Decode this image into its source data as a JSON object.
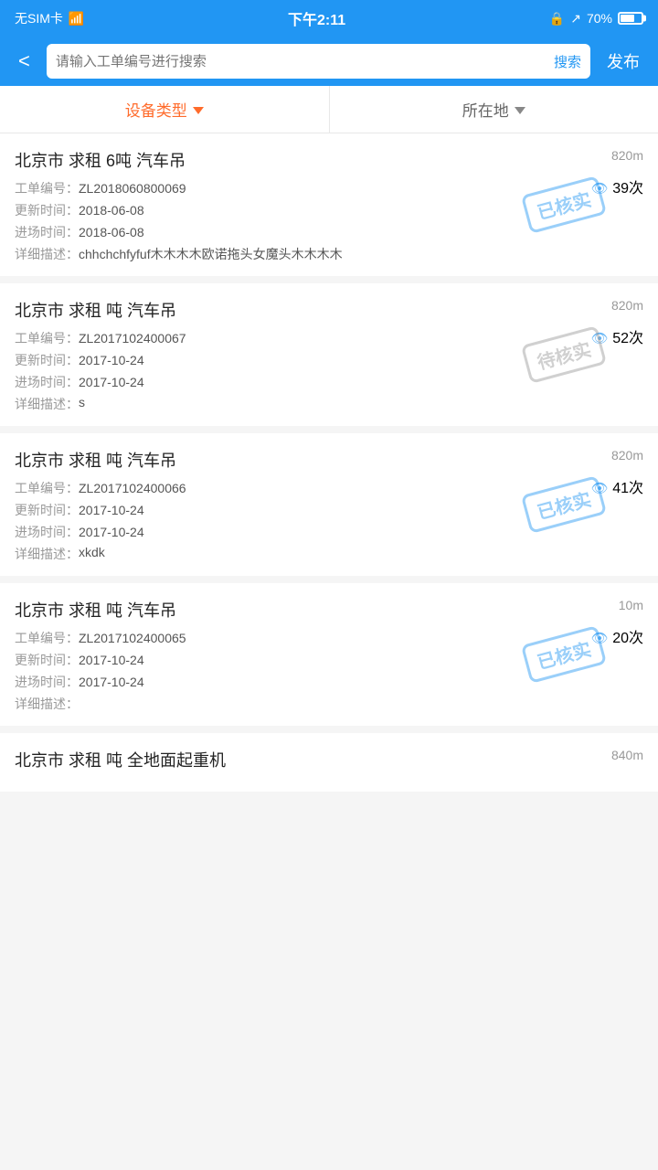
{
  "statusBar": {
    "signal": "无SIM卡",
    "wifi": "WiFi",
    "time": "下午2:11",
    "lock": "🔒",
    "location": "↗",
    "battery": "70%"
  },
  "navBar": {
    "back": "<",
    "searchPlaceholder": "请输入工单编号进行搜索",
    "searchBtn": "搜索",
    "publishBtn": "发布"
  },
  "filters": {
    "type": {
      "label": "设备类型",
      "active": true
    },
    "location": {
      "label": "所在地",
      "active": false
    }
  },
  "items": [
    {
      "title": "北京市 求租 6吨 汽车吊",
      "distance": "820m",
      "orderNo": "ZL2018060800069",
      "views": "39次",
      "updateTime": "2018-06-08",
      "entryTime": "2018-06-08",
      "description": "chhchchfyfuf木木木木欧诺拖头女魔头木木木木",
      "status": "已核实",
      "statusType": "sold"
    },
    {
      "title": "北京市 求租 吨 汽车吊",
      "distance": "820m",
      "orderNo": "ZL2017102400067",
      "views": "52次",
      "updateTime": "2017-10-24",
      "entryTime": "2017-10-24",
      "description": "s",
      "status": "待核实",
      "statusType": "pending"
    },
    {
      "title": "北京市 求租 吨 汽车吊",
      "distance": "820m",
      "orderNo": "ZL2017102400066",
      "views": "41次",
      "updateTime": "2017-10-24",
      "entryTime": "2017-10-24",
      "description": "xkdk",
      "status": "已核实",
      "statusType": "sold"
    },
    {
      "title": "北京市 求租 吨 汽车吊",
      "distance": "10m",
      "orderNo": "ZL2017102400065",
      "views": "20次",
      "updateTime": "2017-10-24",
      "entryTime": "2017-10-24",
      "description": "",
      "status": "已核实",
      "statusType": "sold"
    },
    {
      "title": "北京市 求租 吨 全地面起重机",
      "distance": "840m",
      "orderNo": "",
      "views": "",
      "updateTime": "",
      "entryTime": "",
      "description": "",
      "status": "",
      "statusType": ""
    }
  ],
  "labels": {
    "orderNo": "工单编号：",
    "updateTime": "更新时间：",
    "entryTime": "进场时间：",
    "description": "详细描述："
  }
}
